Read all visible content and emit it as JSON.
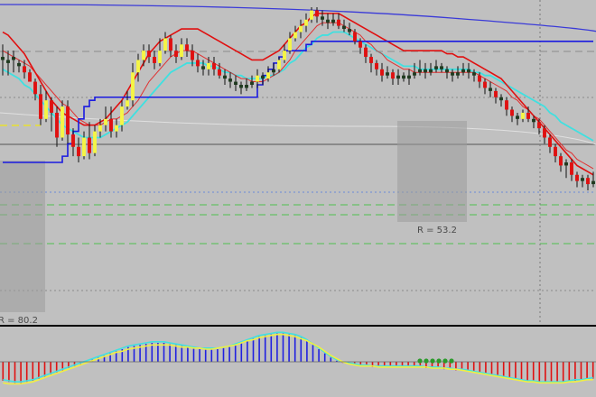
{
  "colors": {
    "background": "#c0c0c0",
    "bull_candle": "#f5f545",
    "bear_candle": "#e01010",
    "neutral_candle": "#1f3a1f",
    "wick": "#111111",
    "red_line": "#e01010",
    "fast_ma": "#e03030",
    "cyan_ma": "#40e0e0",
    "blue_line": "#1a1ae0",
    "top_blue_line": "#3a3ad8",
    "macd_pos": "#2020e0",
    "macd_neg": "#e01010",
    "signal_line": "#f0f040",
    "macd_line": "#40e0e0",
    "dot": "#2a9a2a"
  },
  "chart_data": [
    {
      "type": "candlestick",
      "description_note": "Price panel with overlay moving averages and regression boxes",
      "ylim": [
        0,
        100
      ],
      "grid": true,
      "candles": [
        [
          83,
          84,
          88,
          78
        ],
        [
          82,
          83,
          86,
          78
        ],
        [
          83,
          84,
          86,
          79
        ],
        [
          82,
          81,
          83,
          79
        ],
        [
          81,
          79,
          83,
          77
        ],
        [
          79,
          76,
          80,
          76
        ],
        [
          76,
          72,
          77,
          70
        ],
        [
          72,
          64,
          75,
          62
        ],
        [
          64,
          70,
          73,
          63
        ],
        [
          70,
          66,
          71,
          60
        ],
        [
          66,
          58,
          68,
          55
        ],
        [
          58,
          68,
          70,
          57
        ],
        [
          68,
          59,
          70,
          56
        ],
        [
          59,
          55,
          61,
          52
        ],
        [
          55,
          52,
          58,
          50
        ],
        [
          52,
          58,
          60,
          51
        ],
        [
          58,
          53,
          63,
          51
        ],
        [
          53,
          60,
          62,
          52
        ],
        [
          60,
          62,
          64,
          58
        ],
        [
          62,
          64,
          68,
          60
        ],
        [
          64,
          60,
          68,
          58
        ],
        [
          60,
          62,
          64,
          58
        ],
        [
          62,
          68,
          70,
          60
        ],
        [
          68,
          70,
          73,
          67
        ],
        [
          70,
          79,
          82,
          68
        ],
        [
          79,
          83,
          85,
          76
        ],
        [
          83,
          86,
          88,
          81
        ],
        [
          86,
          84,
          88,
          82
        ],
        [
          84,
          82,
          86,
          80
        ],
        [
          82,
          86,
          90,
          81
        ],
        [
          86,
          90,
          92,
          85
        ],
        [
          90,
          86,
          91,
          84
        ],
        [
          86,
          84,
          88,
          82
        ],
        [
          84,
          88,
          90,
          83
        ],
        [
          88,
          86,
          90,
          84
        ],
        [
          86,
          83,
          88,
          81
        ],
        [
          83,
          81,
          85,
          79
        ],
        [
          81,
          80,
          83,
          78
        ],
        [
          80,
          82,
          84,
          78
        ],
        [
          82,
          80,
          84,
          78
        ],
        [
          80,
          78,
          82,
          77
        ],
        [
          78,
          77,
          80,
          75
        ],
        [
          77,
          76,
          79,
          74
        ],
        [
          76,
          75,
          78,
          73
        ],
        [
          75,
          74,
          76,
          72
        ],
        [
          74,
          75,
          77,
          73
        ],
        [
          75,
          76,
          78,
          74
        ],
        [
          76,
          78,
          80,
          74
        ],
        [
          78,
          77,
          79,
          75
        ],
        [
          77,
          79,
          81,
          76
        ],
        [
          79,
          80,
          82,
          78
        ],
        [
          80,
          83,
          84,
          79
        ],
        [
          83,
          86,
          88,
          82
        ],
        [
          86,
          90,
          92,
          85
        ],
        [
          90,
          92,
          94,
          89
        ],
        [
          92,
          94,
          96,
          90
        ],
        [
          94,
          96,
          98,
          92
        ],
        [
          96,
          99,
          100,
          95
        ],
        [
          99,
          97,
          100,
          95
        ],
        [
          97,
          96,
          99,
          94
        ],
        [
          96,
          95,
          98,
          93
        ],
        [
          95,
          96,
          98,
          94
        ],
        [
          96,
          94,
          98,
          93
        ],
        [
          94,
          93,
          96,
          92
        ],
        [
          93,
          92,
          95,
          91
        ],
        [
          92,
          89,
          93,
          88
        ],
        [
          89,
          87,
          90,
          85
        ],
        [
          87,
          84,
          88,
          82
        ],
        [
          84,
          82,
          85,
          79
        ],
        [
          82,
          80,
          83,
          78
        ],
        [
          80,
          78,
          82,
          76
        ],
        [
          78,
          79,
          81,
          77
        ],
        [
          79,
          77,
          80,
          75
        ],
        [
          77,
          78,
          80,
          75
        ],
        [
          78,
          77,
          79,
          76
        ],
        [
          77,
          78,
          80,
          75
        ],
        [
          78,
          79,
          82,
          77
        ],
        [
          79,
          80,
          83,
          78
        ],
        [
          80,
          79,
          82,
          77
        ],
        [
          79,
          80,
          82,
          78
        ],
        [
          80,
          81,
          83,
          79
        ],
        [
          81,
          80,
          82,
          79
        ],
        [
          80,
          79,
          81,
          77
        ],
        [
          79,
          78,
          80,
          76
        ],
        [
          78,
          79,
          81,
          77
        ],
        [
          79,
          80,
          82,
          78
        ],
        [
          80,
          79,
          82,
          77
        ],
        [
          79,
          78,
          80,
          76
        ],
        [
          78,
          76,
          79,
          74
        ],
        [
          76,
          74,
          77,
          72
        ],
        [
          74,
          73,
          76,
          71
        ],
        [
          73,
          71,
          74,
          69
        ],
        [
          71,
          70,
          72,
          68
        ],
        [
          70,
          67,
          71,
          65
        ],
        [
          67,
          65,
          68,
          63
        ],
        [
          65,
          64,
          66,
          62
        ],
        [
          64,
          66,
          67,
          63
        ],
        [
          66,
          64,
          68,
          63
        ],
        [
          64,
          63,
          65,
          61
        ],
        [
          63,
          61,
          64,
          59
        ],
        [
          61,
          58,
          62,
          56
        ],
        [
          58,
          55,
          59,
          53
        ],
        [
          55,
          52,
          56,
          50
        ],
        [
          52,
          49,
          53,
          47
        ],
        [
          49,
          50,
          51,
          45
        ],
        [
          50,
          46,
          51,
          44
        ],
        [
          46,
          44,
          47,
          42
        ],
        [
          44,
          45,
          46,
          42
        ],
        [
          45,
          43,
          46,
          41
        ],
        [
          43,
          44,
          47,
          42
        ]
      ],
      "red_line": [
        92,
        91,
        89,
        87,
        85,
        82,
        79,
        76,
        73,
        70,
        68,
        66,
        65,
        64,
        63,
        62,
        62,
        62,
        63,
        64,
        66,
        68,
        70,
        73,
        76,
        79,
        82,
        85,
        87,
        89,
        90,
        91,
        92,
        93,
        93,
        93,
        93,
        92,
        91,
        90,
        89,
        88,
        87,
        86,
        85,
        84,
        83,
        83,
        83,
        84,
        85,
        86,
        88,
        90,
        92,
        94,
        95,
        97,
        98,
        98,
        98,
        98,
        98,
        97,
        96,
        95,
        94,
        93,
        92,
        91,
        90,
        89,
        88,
        87,
        86,
        86,
        86,
        86,
        86,
        86,
        86,
        86,
        85,
        85,
        84,
        84,
        83,
        82,
        81,
        80,
        79,
        78,
        77,
        75,
        73,
        71,
        69,
        67,
        65,
        63,
        61,
        59,
        57,
        55,
        53,
        51,
        49,
        48,
        47,
        46
      ],
      "fast_ma": [
        86,
        85,
        84,
        83,
        82,
        81,
        79,
        77,
        75,
        73,
        71,
        69,
        68,
        66,
        64,
        63,
        62,
        62,
        62,
        63,
        64,
        64,
        65,
        66,
        68,
        70,
        73,
        76,
        78,
        80,
        82,
        84,
        85,
        86,
        86,
        86,
        85,
        84,
        83,
        82,
        81,
        80,
        79,
        78,
        77,
        77,
        76,
        76,
        76,
        77,
        78,
        79,
        81,
        83,
        86,
        88,
        90,
        92,
        94,
        95,
        95,
        95,
        95,
        94,
        93,
        92,
        91,
        89,
        88,
        86,
        85,
        83,
        82,
        81,
        80,
        80,
        79,
        79,
        79,
        79,
        79,
        79,
        79,
        79,
        79,
        79,
        79,
        79,
        78,
        77,
        76,
        75,
        74,
        73,
        71,
        70,
        68,
        67,
        65,
        64,
        62,
        60,
        58,
        56,
        54,
        53,
        51,
        50,
        49,
        48
      ],
      "cyan_ma": [
        80,
        79,
        78,
        77,
        75,
        74,
        72,
        70,
        68,
        66,
        64,
        62,
        61,
        60,
        59,
        58,
        58,
        58,
        58,
        59,
        60,
        61,
        62,
        63,
        65,
        67,
        69,
        71,
        73,
        75,
        77,
        79,
        80,
        81,
        82,
        82,
        82,
        82,
        81,
        81,
        80,
        79,
        79,
        78,
        78,
        77,
        77,
        77,
        77,
        78,
        78,
        79,
        80,
        82,
        83,
        85,
        87,
        88,
        90,
        91,
        91,
        92,
        92,
        92,
        91,
        90,
        89,
        88,
        87,
        86,
        85,
        84,
        83,
        82,
        81,
        81,
        81,
        80,
        80,
        80,
        80,
        80,
        80,
        80,
        80,
        80,
        80,
        79,
        79,
        78,
        78,
        77,
        76,
        75,
        74,
        73,
        72,
        71,
        70,
        69,
        68,
        66,
        65,
        63,
        62,
        61,
        60,
        59,
        58,
        57
      ],
      "blue_line": [
        50,
        50,
        50,
        50,
        50,
        50,
        50,
        50,
        50,
        50,
        50,
        52,
        56,
        60,
        64,
        68,
        70,
        71,
        71,
        71,
        71,
        71,
        71,
        71,
        71,
        71,
        71,
        71,
        71,
        71,
        71,
        71,
        71,
        71,
        71,
        71,
        71,
        71,
        71,
        71,
        71,
        71,
        71,
        71,
        71,
        71,
        71,
        75,
        78,
        80,
        82,
        84,
        86,
        86,
        86,
        86,
        88,
        89,
        89,
        89,
        89,
        89,
        89,
        89,
        89,
        89,
        89,
        89,
        89,
        89,
        89,
        89,
        89,
        89,
        89,
        89,
        89,
        89,
        89,
        89,
        89,
        89,
        89,
        89,
        89,
        89,
        89,
        89,
        89,
        89,
        89,
        89,
        89,
        89,
        89,
        89,
        89,
        89,
        89,
        89,
        89,
        89,
        89,
        89,
        89,
        89,
        89,
        89,
        89,
        89
      ],
      "regression_labels": [
        "R = 80.2",
        "R = 53.2"
      ]
    },
    {
      "type": "bar",
      "description_note": "Oscillator histogram panel",
      "ylim": [
        -30,
        30
      ],
      "values": [
        -18,
        -19,
        -20,
        -20,
        -19,
        -18,
        -16,
        -14,
        -12,
        -10,
        -8,
        -6,
        -4,
        -2,
        0,
        2,
        4,
        6,
        8,
        10,
        12,
        14,
        15,
        16,
        17,
        18,
        18,
        18,
        17,
        16,
        15,
        14,
        13,
        12,
        12,
        12,
        12,
        13,
        14,
        16,
        18,
        20,
        22,
        24,
        25,
        26,
        27,
        27,
        26,
        25,
        23,
        20,
        16,
        12,
        8,
        4,
        1,
        -1,
        -2,
        -3,
        -4,
        -4,
        -5,
        -5,
        -5,
        -5,
        -5,
        -5,
        -5,
        -5,
        -5,
        -6,
        -6,
        -6,
        -7,
        -7,
        -8,
        -8,
        -9,
        -10,
        -11,
        -12,
        -13,
        -14,
        -15,
        -16,
        -17,
        -18,
        -19,
        -19,
        -20,
        -20,
        -20,
        -20,
        -20,
        -19,
        -18,
        -18,
        -17,
        -16
      ],
      "signal_line": [
        -20,
        -21,
        -21,
        -21,
        -20,
        -19,
        -17,
        -15,
        -13,
        -11,
        -9,
        -7,
        -5,
        -3,
        -1,
        1,
        3,
        5,
        7,
        9,
        10,
        12,
        13,
        14,
        15,
        16,
        16,
        16,
        16,
        15,
        14,
        14,
        13,
        13,
        12,
        12,
        13,
        14,
        15,
        16,
        18,
        20,
        21,
        23,
        24,
        25,
        26,
        26,
        25,
        24,
        22,
        20,
        17,
        14,
        10,
        6,
        3,
        0,
        -2,
        -3,
        -4,
        -4,
        -4,
        -5,
        -5,
        -5,
        -5,
        -5,
        -5,
        -5,
        -5,
        -5,
        -6,
        -6,
        -6,
        -7,
        -7,
        -8,
        -9,
        -10,
        -11,
        -12,
        -13,
        -14,
        -15,
        -16,
        -17,
        -18,
        -19,
        -19,
        -20,
        -20,
        -20,
        -20,
        -20,
        -19,
        -19,
        -18,
        -17,
        -17
      ]
    }
  ]
}
